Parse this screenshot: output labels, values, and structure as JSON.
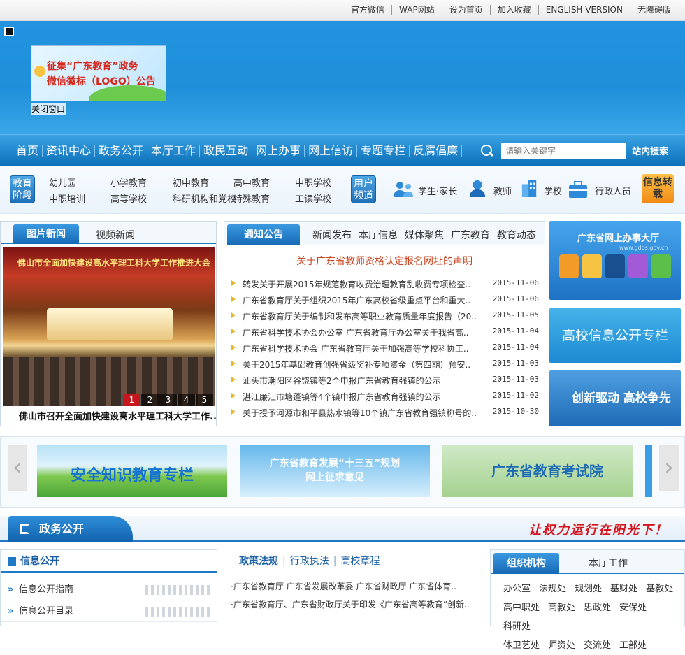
{
  "topbar": {
    "links": [
      "官方微信",
      "WAP网站",
      "设为首页",
      "加入收藏",
      "ENGLISH VERSION",
      "无障碍版"
    ]
  },
  "popup": {
    "line1": "征集“广东教育”政务",
    "line2": "微信徽标（LOGO）公告",
    "close": "关闭窗口"
  },
  "nav": {
    "items": [
      "首页",
      "资讯中心",
      "政务公开",
      "本厅工作",
      "政民互动",
      "网上办事",
      "网上信访",
      "专题专栏",
      "反腐倡廉"
    ],
    "search_placeholder": "请输入关键字",
    "search_button": "站内搜索"
  },
  "channel": {
    "edu_tag": "教育阶段",
    "edu_links": [
      "幼儿园",
      "小学教育",
      "初中教育",
      "高中教育",
      "中职学校",
      "中职培训",
      "高等学校",
      "科研机构和党校",
      "特殊教育",
      "工读学校"
    ],
    "user_tag": "用户频道",
    "users": [
      "学生·家长",
      "教师",
      "学校",
      "行政人员"
    ],
    "xinxi": "信息转载"
  },
  "pictures": {
    "tabs": [
      "图片新闻",
      "视频新闻"
    ],
    "banner_text": "佛山市全面加快建设高水平理工科大学工作推进大会",
    "pager": [
      "1",
      "2",
      "3",
      "4",
      "5"
    ],
    "caption": "佛山市召开全面加快建设高水平理工科大学工作.."
  },
  "notices": {
    "tabs": [
      "通知公告",
      "新闻发布",
      "本厅信息",
      "媒体聚焦",
      "广东教育",
      "教育动态"
    ],
    "headline": "关于广东省教师资格认定报名网址的声明",
    "items": [
      {
        "title": "转发关于开展2015年规范教育收费治理教育乱收费专项检查..",
        "date": "2015-11-06"
      },
      {
        "title": "广东省教育厅关于组织2015年广东高校省级重点平台和重大..",
        "date": "2015-11-06"
      },
      {
        "title": "广东省教育厅关于编制和发布高等职业教育质量年度报告（20..",
        "date": "2015-11-05"
      },
      {
        "title": "广东省科学技术协会办公室 广东省教育厅办公室关于我省高..",
        "date": "2015-11-04"
      },
      {
        "title": "广东省科学技术协会 广东省教育厅关于加强高等学校科协工..",
        "date": "2015-11-04"
      },
      {
        "title": "关于2015年基础教育创强省级奖补专项资金（第四期）预安..",
        "date": "2015-11-03"
      },
      {
        "title": "汕头市潮阳区谷饶镇等2个申报广东省教育强镇的公示",
        "date": "2015-11-03"
      },
      {
        "title": "湛江廉江市塘蓬镇等4个镇申报广东省教育强镇的公示",
        "date": "2015-11-02"
      },
      {
        "title": "关于授予河源市和平县热水镇等10个镇广东省教育强镇称号的..",
        "date": "2015-10-30"
      }
    ]
  },
  "side": {
    "hall": "广东省网上办事大厅",
    "hall_sub": "www.gdbs.gov.cn",
    "college": "高校信息公开专栏",
    "innovate": "创新驱动 高校争先"
  },
  "carousel": {
    "prev": "‹",
    "next": "›",
    "b1": "安全知识教育专栏",
    "b2_line1": "广东省教育发展“十三五”规划",
    "b2_line2": "网上征求意见",
    "b3": "广东省教育考试院"
  },
  "gov": {
    "title": "政务公开",
    "slogan": "让权力运行在阳光下！"
  },
  "info": {
    "title": "信息公开",
    "rows": [
      "信息公开指南",
      "信息公开目录"
    ]
  },
  "policy": {
    "tabs": [
      "政策法规",
      "行政执法",
      "高校章程"
    ],
    "rows": [
      "·广东省教育厅 广东省发展改革委 广东省财政厅 广东省体育..",
      "·广东省教育厅、广东省财政厅关于印发《广东省高等教育“创新.."
    ]
  },
  "org": {
    "tabs": [
      "组织机构",
      "本厅工作"
    ],
    "items": [
      "办公室",
      "法规处",
      "规划处",
      "基财处",
      "基教处",
      "高中职处",
      "高教处",
      "思政处",
      "安保处",
      "科研处",
      "体卫艺处",
      "师资处",
      "交流处",
      "工部处"
    ]
  }
}
